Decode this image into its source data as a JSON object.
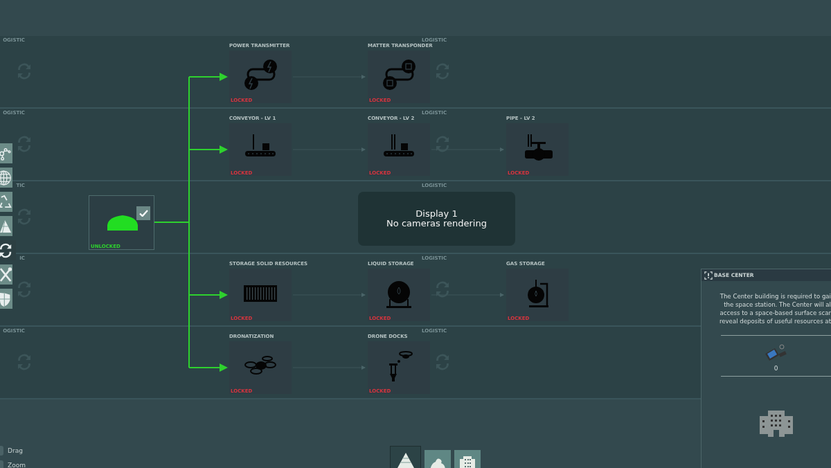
{
  "rows": [
    {
      "left_label": "OGISTIC",
      "center_label": "LOGISTIC",
      "nodes": [
        {
          "title": "POWER TRANSMITTER",
          "status": "LOCKED",
          "unlocked": false
        },
        {
          "title": "MATTER TRANSPONDER",
          "status": "LOCKED",
          "unlocked": false
        }
      ]
    },
    {
      "left_label": "OGISTIC",
      "center_label": "LOGISTIC",
      "nodes": [
        {
          "title": "CONVEYOR - LV 1",
          "status": "LOCKED",
          "unlocked": false
        },
        {
          "title": "CONVEYOR - LV 2",
          "status": "LOCKED",
          "unlocked": false
        },
        {
          "title": "PIPE - LV 2",
          "status": "LOCKED",
          "unlocked": false
        }
      ]
    },
    {
      "left_label": "TIC",
      "center_label": "LOGISTIC"
    },
    {
      "left_label": "IC",
      "center_label": "LOGISTIC",
      "nodes": [
        {
          "title": "STORAGE SOLID RESOURCES",
          "status": "LOCKED",
          "unlocked": false
        },
        {
          "title": "LIQUID STORAGE",
          "status": "LOCKED",
          "unlocked": false
        },
        {
          "title": "GAS STORAGE",
          "status": "LOCKED",
          "unlocked": false
        }
      ]
    },
    {
      "left_label": "OGISTIC",
      "center_label": "LOGISTIC",
      "nodes": [
        {
          "title": "DRONATIZATION",
          "status": "LOCKED",
          "unlocked": false
        },
        {
          "title": "DRONE DOCKS",
          "status": "LOCKED",
          "unlocked": false
        }
      ]
    }
  ],
  "unlocked_node": {
    "status": "UNLOCKED",
    "unlocked": true,
    "checked": true
  },
  "sidebar": [
    {
      "selected": false
    },
    {
      "selected": false
    },
    {
      "selected": false
    },
    {
      "selected": false
    },
    {
      "selected": true
    },
    {
      "selected": false
    },
    {
      "selected": false
    }
  ],
  "overlay": {
    "title": "Display 1",
    "message": "No cameras rendering"
  },
  "info_panel": {
    "title": "BASE CENTER",
    "description_lines": [
      "The Center building is required to gai",
      "the space station. The Center will al",
      "access to a space-based surface scar",
      "reveal deposits of useful resources at"
    ],
    "count": "0"
  },
  "controls": [
    {
      "label": "Drag"
    },
    {
      "label": "Zoom"
    }
  ],
  "bottom_tabs": [
    {
      "selected": true
    },
    {
      "selected": false
    },
    {
      "selected": false
    }
  ]
}
